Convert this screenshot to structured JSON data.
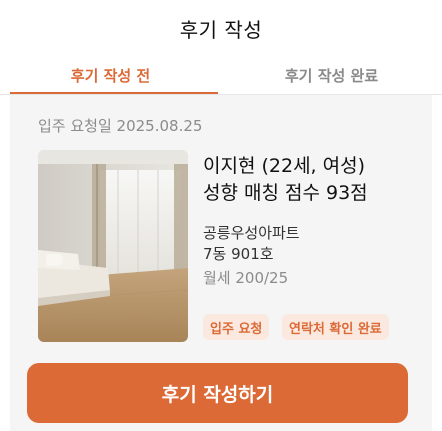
{
  "header": {
    "title": "후기 작성"
  },
  "tabs": [
    {
      "label": "후기 작성 전",
      "active": true
    },
    {
      "label": "후기 작성 완료",
      "active": false
    }
  ],
  "card": {
    "move_in_label": "입주 요청일 2025.08.25",
    "tenant_line": "이지현 (22세, 여성)",
    "match_line": "성향 매칭 점수 93점",
    "apartment": "공릉우성아파트",
    "unit": "7동 901호",
    "rent": "월세 200/25",
    "badges": [
      "입주 요청",
      "연락처 확인 완료"
    ],
    "photo_icon": "apartment-interior-photo"
  },
  "cta": {
    "label": "후기 작성하기"
  },
  "colors": {
    "accent": "#dc6a37",
    "badge_bg": "#fbe9df",
    "content_bg": "#f5f5f5"
  }
}
